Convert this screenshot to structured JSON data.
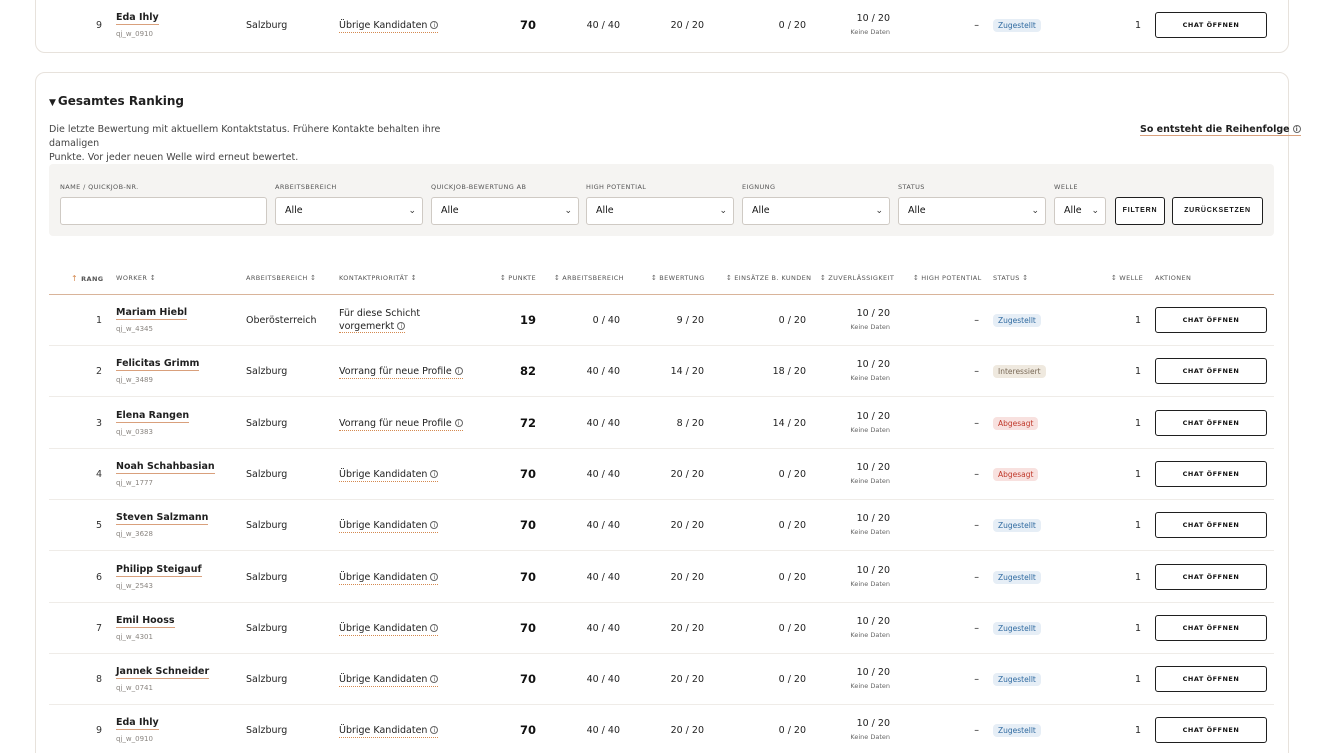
{
  "top_row": {
    "rank": "9",
    "name": "Eda Ihly",
    "id": "qj_w_0910",
    "area": "Salzburg",
    "priority": "Übrige Kandidaten",
    "points": "70",
    "arbeitsbereich": "40 / 40",
    "bewertung": "20 / 20",
    "einsaetze": "0 / 20",
    "zuverl": "10 / 20",
    "zuverl_sub": "Keine Daten",
    "high_potential": "–",
    "status": "Zugestellt",
    "status_kind": "blue",
    "welle": "1",
    "action": "CHAT ÖFFNEN"
  },
  "section": {
    "title": "Gesamtes Ranking",
    "description_line1": "Die letzte Bewertung mit aktuellem Kontaktstatus. Frühere Kontakte behalten ihre damaligen",
    "description_line2": "Punkte. Vor jeder neuen Welle wird erneut bewertet.",
    "explain_link": "So entsteht die Reihenfolge"
  },
  "filters": {
    "name_label": "NAME / QUICKJOB-NR.",
    "name_value": "",
    "arbeitsbereich_label": "ARBEITSBEREICH",
    "arbeitsbereich_value": "Alle",
    "bewertung_label": "QUICKJOB-BEWERTUNG AB",
    "bewertung_value": "Alle",
    "hp_label": "HIGH POTENTIAL",
    "hp_value": "Alle",
    "eignung_label": "EIGNUNG",
    "eignung_value": "Alle",
    "status_label": "STATUS",
    "status_value": "Alle",
    "welle_label": "WELLE",
    "welle_value": "Alle",
    "filter_button": "FILTERN",
    "reset_button": "ZURÜCKSETZEN"
  },
  "headers": {
    "rang": "RANG",
    "worker": "WORKER",
    "arbeitsbereich": "ARBEITSBEREICH",
    "kontakt": "KONTAKTPRIORITÄT",
    "punkte": "PUNKTE",
    "arbeitsbereich2": "ARBEITSBEREICH",
    "bewertung": "BEWERTUNG",
    "einsaetze": "EINSÄTZE B. KUNDEN",
    "zuverl": "ZUVERLÄSSIGKEIT",
    "hp": "HIGH POTENTIAL",
    "status": "STATUS",
    "welle": "WELLE",
    "aktionen": "AKTIONEN"
  },
  "rows": [
    {
      "rank": "1",
      "name": "Mariam Hiebl",
      "id": "qj_w_4345",
      "area": "Oberösterreich",
      "priority_l1": "Für diese Schicht",
      "priority_l2": "vorgemerkt",
      "points": "19",
      "arbeitsbereich": "0 / 40",
      "bewertung": "9 / 20",
      "einsaetze": "0 / 20",
      "zuverl": "10 / 20",
      "zuverl_sub": "Keine Daten",
      "high_potential": "–",
      "status": "Zugestellt",
      "status_kind": "blue",
      "welle": "1",
      "action": "CHAT ÖFFNEN"
    },
    {
      "rank": "2",
      "name": "Felicitas Grimm",
      "id": "qj_w_3489",
      "area": "Salzburg",
      "priority": "Vorrang für neue Profile",
      "points": "82",
      "arbeitsbereich": "40 / 40",
      "bewertung": "14 / 20",
      "einsaetze": "18 / 20",
      "zuverl": "10 / 20",
      "zuverl_sub": "Keine Daten",
      "high_potential": "–",
      "status": "Interessiert",
      "status_kind": "beige",
      "welle": "1",
      "action": "CHAT ÖFFNEN"
    },
    {
      "rank": "3",
      "name": "Elena Rangen",
      "id": "qj_w_0383",
      "area": "Salzburg",
      "priority": "Vorrang für neue Profile",
      "points": "72",
      "arbeitsbereich": "40 / 40",
      "bewertung": "8 / 20",
      "einsaetze": "14 / 20",
      "zuverl": "10 / 20",
      "zuverl_sub": "Keine Daten",
      "high_potential": "–",
      "status": "Abgesagt",
      "status_kind": "red",
      "welle": "1",
      "action": "CHAT ÖFFNEN"
    },
    {
      "rank": "4",
      "name": "Noah Schahbasian",
      "id": "qj_w_1777",
      "area": "Salzburg",
      "priority": "Übrige Kandidaten",
      "points": "70",
      "arbeitsbereich": "40 / 40",
      "bewertung": "20 / 20",
      "einsaetze": "0 / 20",
      "zuverl": "10 / 20",
      "zuverl_sub": "Keine Daten",
      "high_potential": "–",
      "status": "Abgesagt",
      "status_kind": "red",
      "welle": "1",
      "action": "CHAT ÖFFNEN"
    },
    {
      "rank": "5",
      "name": "Steven Salzmann",
      "id": "qj_w_3628",
      "area": "Salzburg",
      "priority": "Übrige Kandidaten",
      "points": "70",
      "arbeitsbereich": "40 / 40",
      "bewertung": "20 / 20",
      "einsaetze": "0 / 20",
      "zuverl": "10 / 20",
      "zuverl_sub": "Keine Daten",
      "high_potential": "–",
      "status": "Zugestellt",
      "status_kind": "blue",
      "welle": "1",
      "action": "CHAT ÖFFNEN"
    },
    {
      "rank": "6",
      "name": "Philipp Steigauf",
      "id": "qj_w_2543",
      "area": "Salzburg",
      "priority": "Übrige Kandidaten",
      "points": "70",
      "arbeitsbereich": "40 / 40",
      "bewertung": "20 / 20",
      "einsaetze": "0 / 20",
      "zuverl": "10 / 20",
      "zuverl_sub": "Keine Daten",
      "high_potential": "–",
      "status": "Zugestellt",
      "status_kind": "blue",
      "welle": "1",
      "action": "CHAT ÖFFNEN"
    },
    {
      "rank": "7",
      "name": "Emil Hooss",
      "id": "qj_w_4301",
      "area": "Salzburg",
      "priority": "Übrige Kandidaten",
      "points": "70",
      "arbeitsbereich": "40 / 40",
      "bewertung": "20 / 20",
      "einsaetze": "0 / 20",
      "zuverl": "10 / 20",
      "zuverl_sub": "Keine Daten",
      "high_potential": "–",
      "status": "Zugestellt",
      "status_kind": "blue",
      "welle": "1",
      "action": "CHAT ÖFFNEN"
    },
    {
      "rank": "8",
      "name": "Jannek Schneider",
      "id": "qj_w_0741",
      "area": "Salzburg",
      "priority": "Übrige Kandidaten",
      "points": "70",
      "arbeitsbereich": "40 / 40",
      "bewertung": "20 / 20",
      "einsaetze": "0 / 20",
      "zuverl": "10 / 20",
      "zuverl_sub": "Keine Daten",
      "high_potential": "–",
      "status": "Zugestellt",
      "status_kind": "blue",
      "welle": "1",
      "action": "CHAT ÖFFNEN"
    },
    {
      "rank": "9",
      "name": "Eda Ihly",
      "id": "qj_w_0910",
      "area": "Salzburg",
      "priority": "Übrige Kandidaten",
      "points": "70",
      "arbeitsbereich": "40 / 40",
      "bewertung": "20 / 20",
      "einsaetze": "0 / 20",
      "zuverl": "10 / 20",
      "zuverl_sub": "Keine Daten",
      "high_potential": "–",
      "status": "Zugestellt",
      "status_kind": "blue",
      "welle": "1",
      "action": "CHAT ÖFFNEN"
    }
  ]
}
